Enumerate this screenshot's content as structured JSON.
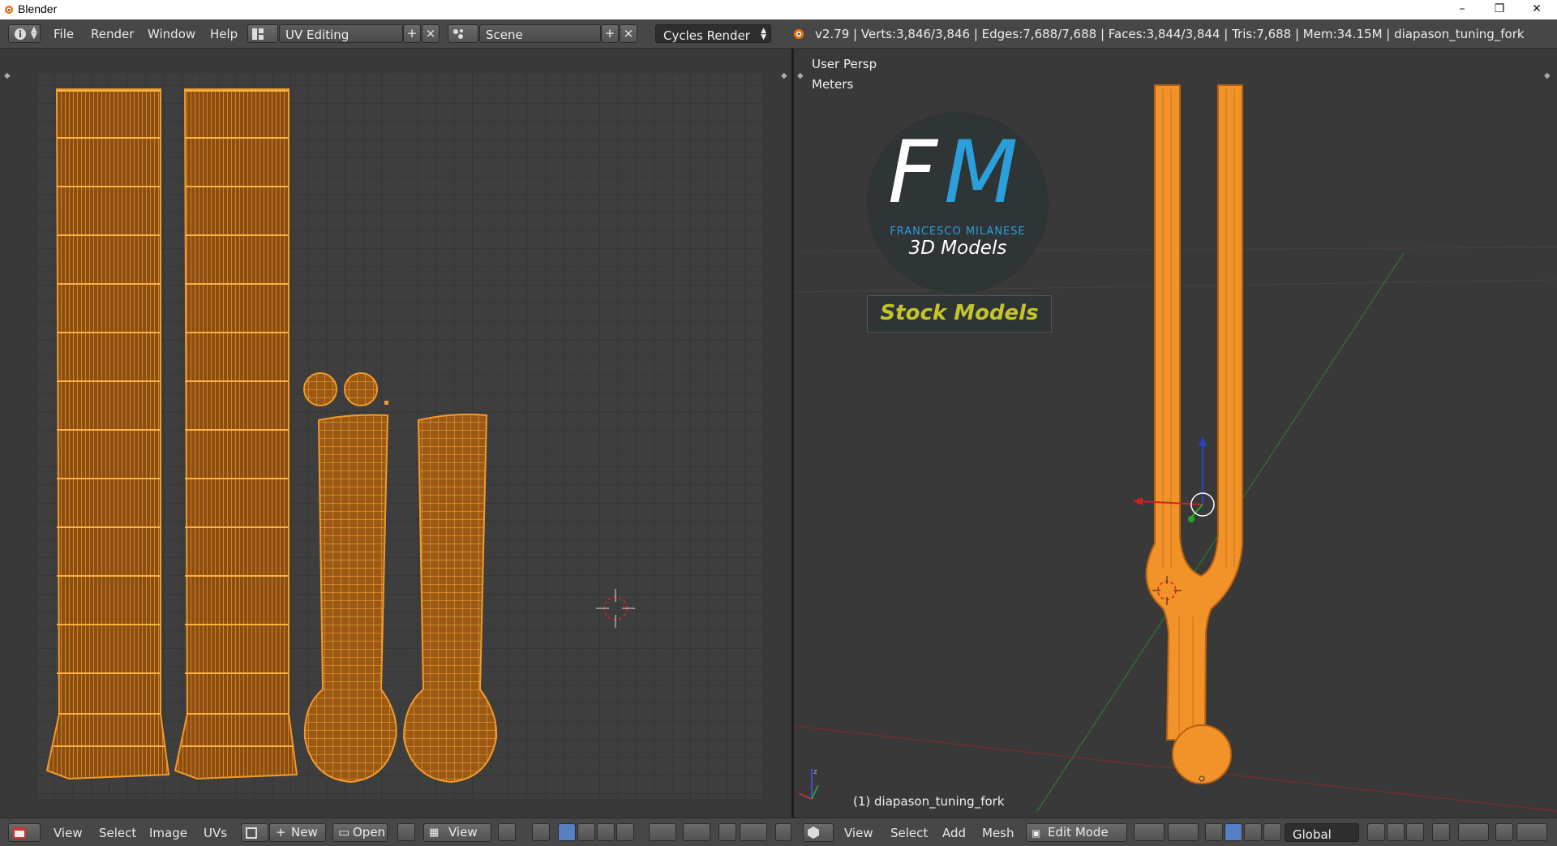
{
  "window": {
    "title": "Blender",
    "minimize": "–",
    "maximize": "❐",
    "close": "✕"
  },
  "header": {
    "menus": [
      "File",
      "Render",
      "Window",
      "Help"
    ],
    "layout": "UV Editing",
    "scene": "Scene",
    "engine": "Cycles Render",
    "stats": "v2.79 | Verts:3,846/3,846 | Edges:7,688/7,688 | Faces:3,844/3,844 | Tris:7,688 | Mem:34.15M | diapason_tuning_fork"
  },
  "viewport": {
    "view_name": "User Persp",
    "units": "Meters",
    "object_label": "(1) diapason_tuning_fork",
    "logo": {
      "initials_f": "F",
      "initials_m": "M",
      "name": "FRANCESCO MILANESE",
      "sub": "3D Models",
      "banner": "Stock Models"
    }
  },
  "uv_footer": {
    "menus": [
      "View",
      "Select",
      "Image",
      "UVs"
    ],
    "new_label": "New",
    "open_label": "Open",
    "view_label": "View"
  },
  "view3d_footer": {
    "menus": [
      "View",
      "Select",
      "Add",
      "Mesh"
    ],
    "mode": "Edit Mode",
    "orientation": "Global"
  },
  "colors": {
    "accent": "#f2932a",
    "wire": "#c86a10",
    "logo_blue": "#2b9fd9",
    "logo_yellow": "#c5c52a",
    "grid": "#444444"
  }
}
